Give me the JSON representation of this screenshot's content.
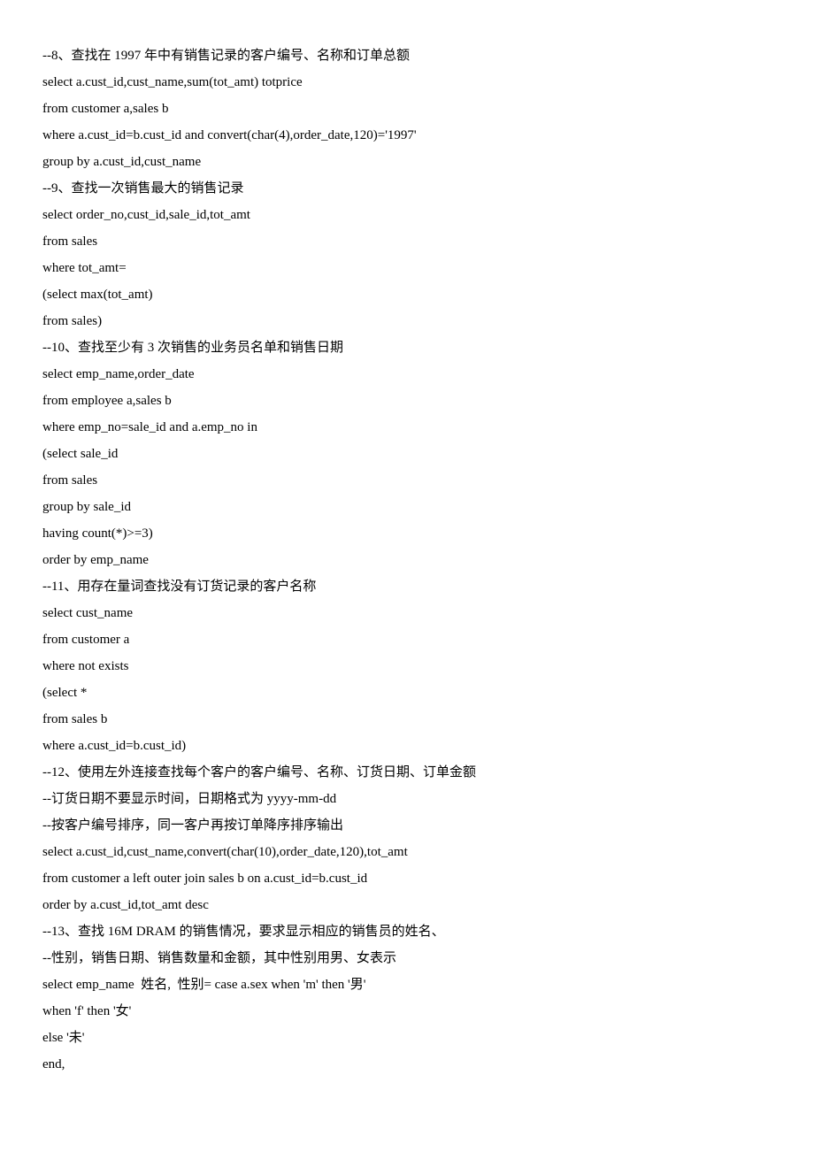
{
  "lines": [
    "--8、查找在 1997 年中有销售记录的客户编号、名称和订单总额",
    "select a.cust_id,cust_name,sum(tot_amt) totprice",
    "from customer a,sales b",
    "where a.cust_id=b.cust_id and convert(char(4),order_date,120)='1997'",
    "group by a.cust_id,cust_name",
    "--9、查找一次销售最大的销售记录",
    "select order_no,cust_id,sale_id,tot_amt",
    "from sales",
    "where tot_amt=",
    "(select max(tot_amt)",
    "from sales)",
    "--10、查找至少有 3 次销售的业务员名单和销售日期",
    "select emp_name,order_date",
    "from employee a,sales b",
    "where emp_no=sale_id and a.emp_no in",
    "(select sale_id",
    "from sales",
    "group by sale_id",
    "having count(*)>=3)",
    "order by emp_name",
    "--11、用存在量词查找没有订货记录的客户名称",
    "select cust_name",
    "from customer a",
    "where not exists",
    "(select *",
    "from sales b",
    "where a.cust_id=b.cust_id)",
    "--12、使用左外连接查找每个客户的客户编号、名称、订货日期、订单金额",
    "--订货日期不要显示时间，日期格式为 yyyy-mm-dd",
    "--按客户编号排序，同一客户再按订单降序排序输出",
    "select a.cust_id,cust_name,convert(char(10),order_date,120),tot_amt",
    "from customer a left outer join sales b on a.cust_id=b.cust_id",
    "order by a.cust_id,tot_amt desc",
    "--13、查找 16M DRAM 的销售情况，要求显示相应的销售员的姓名、",
    "--性别，销售日期、销售数量和金额，其中性别用男、女表示",
    "select emp_name  姓名,  性别= case a.sex when 'm' then '男'",
    "when 'f' then '女'",
    "else '未'",
    "end,"
  ]
}
